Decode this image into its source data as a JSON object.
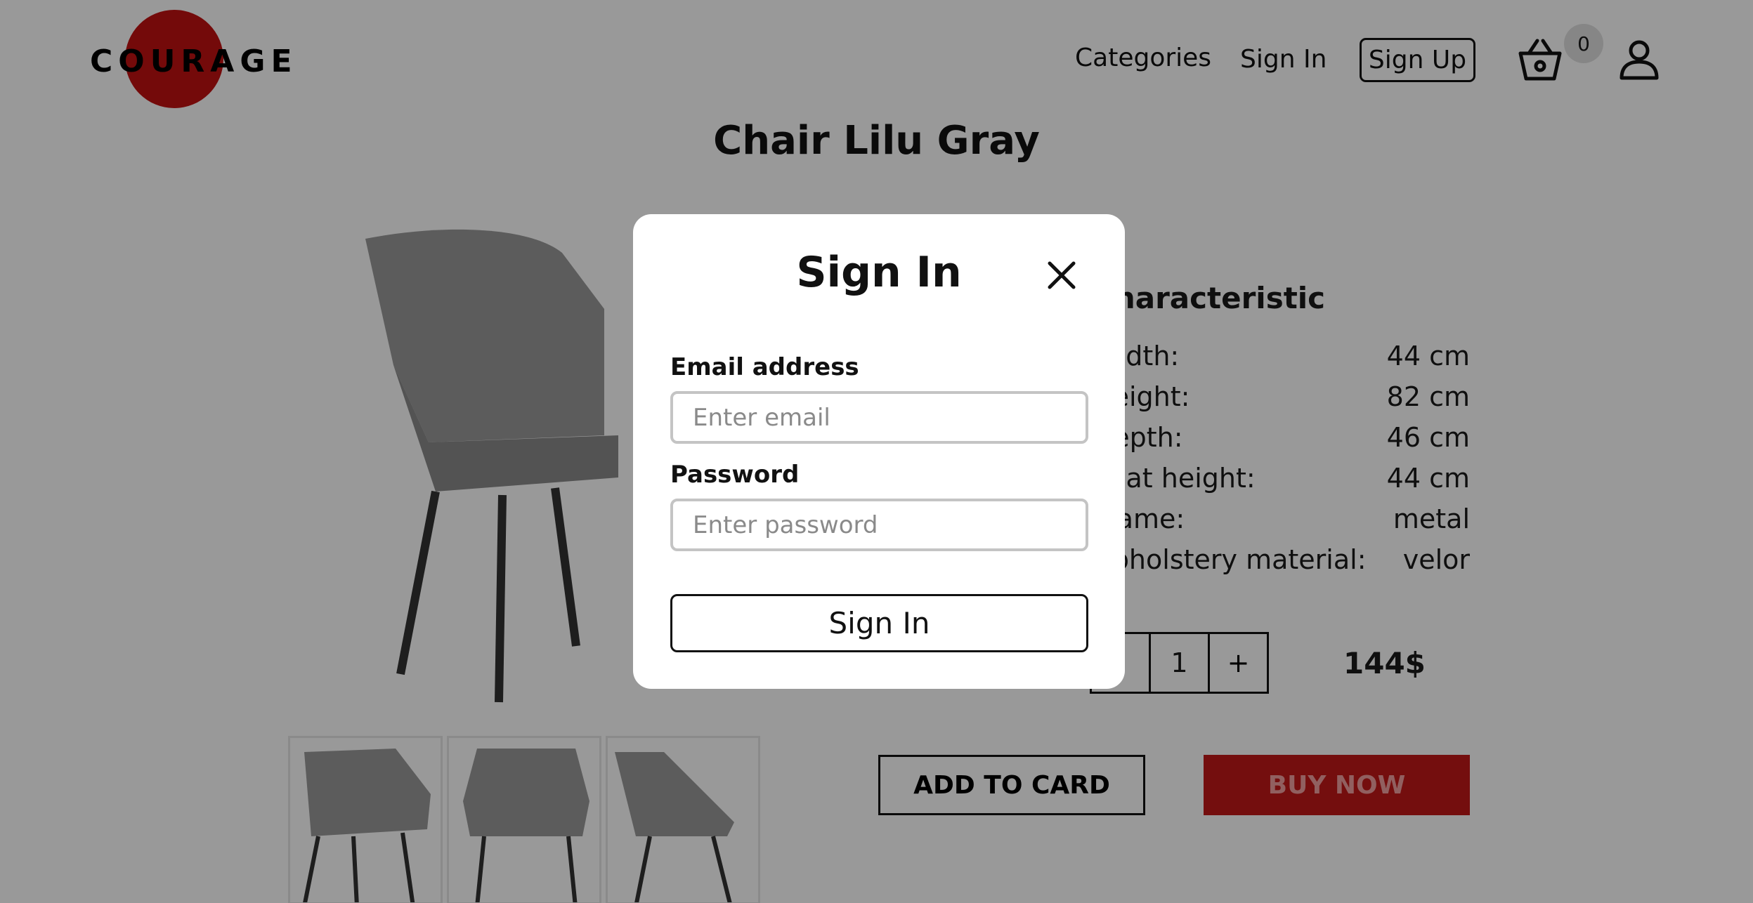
{
  "header": {
    "logo_text": "COURAGE",
    "nav": {
      "categories": "Categories",
      "sign_in": "Sign In",
      "sign_up": "Sign Up"
    },
    "cart_count": "0",
    "icons": {
      "cart": "basket-icon",
      "user": "user-icon"
    }
  },
  "product": {
    "title": "Chair Lilu Gray",
    "characteristics_title": "Characteristic",
    "characteristics": [
      {
        "label": "Width:",
        "value": "44 cm"
      },
      {
        "label": "Height:",
        "value": "82 cm"
      },
      {
        "label": "Depth:",
        "value": "46 cm"
      },
      {
        "label": "Seat height:",
        "value": "44 cm"
      },
      {
        "label": "Frame:",
        "value": "metal"
      },
      {
        "label": "Upholstery material:",
        "value": "velor"
      }
    ],
    "quantity": "1",
    "decrement": "-",
    "increment": "+",
    "price": "144$",
    "add_to_cart_label": "ADD TO CARD",
    "buy_now_label": "BUY NOW"
  },
  "modal": {
    "title": "Sign In",
    "email_label": "Email address",
    "email_placeholder": "Enter email",
    "password_label": "Password",
    "password_placeholder": "Enter password",
    "submit_label": "Sign In"
  },
  "colors": {
    "brand_red": "#c21111",
    "buy_button": "#c21818",
    "overlay": "rgba(0,0,0,0.40)"
  }
}
